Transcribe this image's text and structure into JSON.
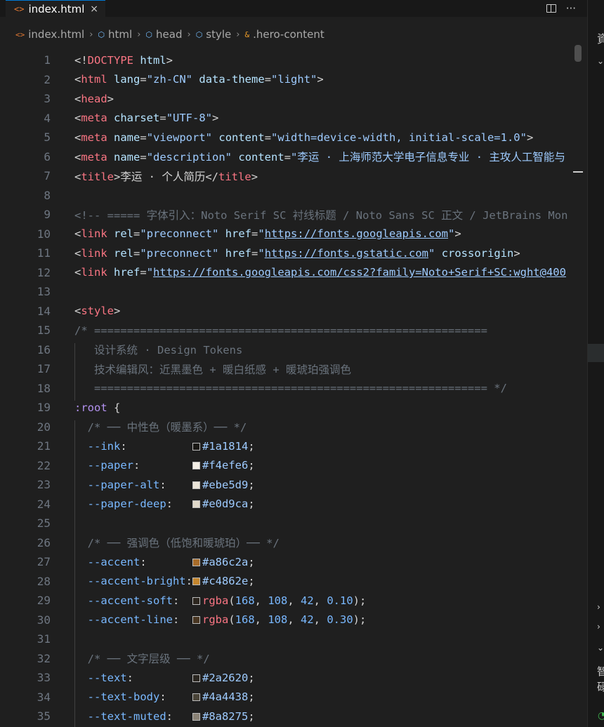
{
  "tab": {
    "icon": "<>",
    "label": "index.html",
    "close": "×"
  },
  "tab_actions": {
    "more": "···"
  },
  "breadcrumb": [
    {
      "icon": "<>",
      "kind": "html",
      "label": "index.html"
    },
    {
      "icon": "⬡",
      "kind": "elem",
      "label": "html"
    },
    {
      "icon": "⬡",
      "kind": "elem",
      "label": "head"
    },
    {
      "icon": "⬡",
      "kind": "elem",
      "label": "style"
    },
    {
      "icon": "&",
      "kind": "cls",
      "label": ".hero-content"
    }
  ],
  "lines": [
    [
      [
        "t-punc",
        "<!"
      ],
      [
        "t-doctype",
        "DOCTYPE"
      ],
      [
        "t-punc",
        " "
      ],
      [
        "t-attr",
        "html"
      ],
      [
        "t-punc",
        ">"
      ]
    ],
    [
      [
        "t-punc",
        "<"
      ],
      [
        "t-tag",
        "html"
      ],
      [
        "t-punc",
        " "
      ],
      [
        "t-attr",
        "lang"
      ],
      [
        "t-punc",
        "="
      ],
      [
        "t-str",
        "\"zh-CN\""
      ],
      [
        "t-punc",
        " "
      ],
      [
        "t-attr",
        "data-theme"
      ],
      [
        "t-punc",
        "="
      ],
      [
        "t-str",
        "\"light\""
      ],
      [
        "t-punc",
        ">"
      ]
    ],
    [
      [
        "t-punc",
        "<"
      ],
      [
        "t-tag",
        "head"
      ],
      [
        "t-punc",
        ">"
      ]
    ],
    [
      [
        "t-punc",
        "<"
      ],
      [
        "t-tag",
        "meta"
      ],
      [
        "t-punc",
        " "
      ],
      [
        "t-attr",
        "charset"
      ],
      [
        "t-punc",
        "="
      ],
      [
        "t-str",
        "\"UTF-8\""
      ],
      [
        "t-punc",
        ">"
      ]
    ],
    [
      [
        "t-punc",
        "<"
      ],
      [
        "t-tag",
        "meta"
      ],
      [
        "t-punc",
        " "
      ],
      [
        "t-attr",
        "name"
      ],
      [
        "t-punc",
        "="
      ],
      [
        "t-str",
        "\"viewport\""
      ],
      [
        "t-punc",
        " "
      ],
      [
        "t-attr",
        "content"
      ],
      [
        "t-punc",
        "="
      ],
      [
        "t-str",
        "\"width=device-width, initial-scale=1.0\""
      ],
      [
        "t-punc",
        ">"
      ]
    ],
    [
      [
        "t-punc",
        "<"
      ],
      [
        "t-tag",
        "meta"
      ],
      [
        "t-punc",
        " "
      ],
      [
        "t-attr",
        "name"
      ],
      [
        "t-punc",
        "="
      ],
      [
        "t-str",
        "\"description\""
      ],
      [
        "t-punc",
        " "
      ],
      [
        "t-attr",
        "content"
      ],
      [
        "t-punc",
        "="
      ],
      [
        "t-str",
        "\"李运 · 上海师范大学电子信息专业 · 主攻人工智能与"
      ]
    ],
    [
      [
        "t-punc",
        "<"
      ],
      [
        "t-tag",
        "title"
      ],
      [
        "t-punc",
        ">李运 · 个人简历</"
      ],
      [
        "t-tag",
        "title"
      ],
      [
        "t-punc",
        ">"
      ]
    ],
    [],
    [
      [
        "t-comment",
        "<!-- ===== 字体引入：Noto Serif SC 衬线标题 / Noto Sans SC 正文 / JetBrains Mon"
      ]
    ],
    [
      [
        "t-punc",
        "<"
      ],
      [
        "t-tag",
        "link"
      ],
      [
        "t-punc",
        " "
      ],
      [
        "t-attr",
        "rel"
      ],
      [
        "t-punc",
        "="
      ],
      [
        "t-str",
        "\"preconnect\""
      ],
      [
        "t-punc",
        " "
      ],
      [
        "t-attr",
        "href"
      ],
      [
        "t-punc",
        "="
      ],
      [
        "t-str",
        "\""
      ],
      [
        "t-url",
        "https://fonts.googleapis.com"
      ],
      [
        "t-str",
        "\""
      ],
      [
        "t-punc",
        ">"
      ]
    ],
    [
      [
        "t-punc",
        "<"
      ],
      [
        "t-tag",
        "link"
      ],
      [
        "t-punc",
        " "
      ],
      [
        "t-attr",
        "rel"
      ],
      [
        "t-punc",
        "="
      ],
      [
        "t-str",
        "\"preconnect\""
      ],
      [
        "t-punc",
        " "
      ],
      [
        "t-attr",
        "href"
      ],
      [
        "t-punc",
        "="
      ],
      [
        "t-str",
        "\""
      ],
      [
        "t-url",
        "https://fonts.gstatic.com"
      ],
      [
        "t-str",
        "\""
      ],
      [
        "t-punc",
        " "
      ],
      [
        "t-attr",
        "crossorigin"
      ],
      [
        "t-punc",
        ">"
      ]
    ],
    [
      [
        "t-punc",
        "<"
      ],
      [
        "t-tag",
        "link"
      ],
      [
        "t-punc",
        " "
      ],
      [
        "t-attr",
        "href"
      ],
      [
        "t-punc",
        "="
      ],
      [
        "t-str",
        "\""
      ],
      [
        "t-url",
        "https://fonts.googleapis.com/css2?family=Noto+Serif+SC:wght@400"
      ]
    ],
    [],
    [
      [
        "t-punc",
        "<"
      ],
      [
        "t-tag",
        "style"
      ],
      [
        "t-punc",
        ">"
      ]
    ],
    [
      [
        "t-comment",
        "/* ============================================================"
      ]
    ],
    [
      [
        "t-comment",
        "   设计系统 · Design Tokens"
      ]
    ],
    [
      [
        "t-comment",
        "   技术编辑风：近黑墨色 + 暖白纸感 + 暖琥珀强调色"
      ]
    ],
    [
      [
        "t-comment",
        "   ============================================================ */"
      ]
    ],
    [
      [
        "t-sel",
        ":root"
      ],
      [
        "t-punc",
        " {"
      ]
    ],
    [
      [
        "t-comment",
        "  /* ── 中性色（暖墨系）── */"
      ]
    ],
    [
      [
        "t-prop",
        "  --ink"
      ],
      [
        "t-punc",
        ":          "
      ],
      [
        "swatch",
        "#1a1814"
      ],
      [
        "t-val",
        "#1a1814"
      ],
      [
        "t-punc",
        ";"
      ]
    ],
    [
      [
        "t-prop",
        "  --paper"
      ],
      [
        "t-punc",
        ":        "
      ],
      [
        "swatch",
        "#f4efe6"
      ],
      [
        "t-val",
        "#f4efe6"
      ],
      [
        "t-punc",
        ";"
      ]
    ],
    [
      [
        "t-prop",
        "  --paper-alt"
      ],
      [
        "t-punc",
        ":    "
      ],
      [
        "swatch",
        "#ebe5d9"
      ],
      [
        "t-val",
        "#ebe5d9"
      ],
      [
        "t-punc",
        ";"
      ]
    ],
    [
      [
        "t-prop",
        "  --paper-deep"
      ],
      [
        "t-punc",
        ":   "
      ],
      [
        "swatch",
        "#e0d9ca"
      ],
      [
        "t-val",
        "#e0d9ca"
      ],
      [
        "t-punc",
        ";"
      ]
    ],
    [],
    [
      [
        "t-comment",
        "  /* ── 强调色（低饱和暖琥珀）── */"
      ]
    ],
    [
      [
        "t-prop",
        "  --accent"
      ],
      [
        "t-punc",
        ":       "
      ],
      [
        "swatch",
        "#a86c2a"
      ],
      [
        "t-val",
        "#a86c2a"
      ],
      [
        "t-punc",
        ";"
      ]
    ],
    [
      [
        "t-prop",
        "  --accent-bright"
      ],
      [
        "t-punc",
        ":"
      ],
      [
        "swatch",
        "#c4862e"
      ],
      [
        "t-val",
        "#c4862e"
      ],
      [
        "t-punc",
        ";"
      ]
    ],
    [
      [
        "t-prop",
        "  --accent-soft"
      ],
      [
        "t-punc",
        ":  "
      ],
      [
        "swatch",
        "rgba(168,108,42,0.10)"
      ],
      [
        "t-fn",
        "rgba"
      ],
      [
        "t-punc",
        "("
      ],
      [
        "t-num",
        "168"
      ],
      [
        "t-punc",
        ", "
      ],
      [
        "t-num",
        "108"
      ],
      [
        "t-punc",
        ", "
      ],
      [
        "t-num",
        "42"
      ],
      [
        "t-punc",
        ", "
      ],
      [
        "t-num",
        "0.10"
      ],
      [
        "t-punc",
        ");"
      ]
    ],
    [
      [
        "t-prop",
        "  --accent-line"
      ],
      [
        "t-punc",
        ":  "
      ],
      [
        "swatch",
        "rgba(168,108,42,0.30)"
      ],
      [
        "t-fn",
        "rgba"
      ],
      [
        "t-punc",
        "("
      ],
      [
        "t-num",
        "168"
      ],
      [
        "t-punc",
        ", "
      ],
      [
        "t-num",
        "108"
      ],
      [
        "t-punc",
        ", "
      ],
      [
        "t-num",
        "42"
      ],
      [
        "t-punc",
        ", "
      ],
      [
        "t-num",
        "0.30"
      ],
      [
        "t-punc",
        ");"
      ]
    ],
    [],
    [
      [
        "t-comment",
        "  /* ── 文字层级 ── */"
      ]
    ],
    [
      [
        "t-prop",
        "  --text"
      ],
      [
        "t-punc",
        ":         "
      ],
      [
        "swatch",
        "#2a2620"
      ],
      [
        "t-val",
        "#2a2620"
      ],
      [
        "t-punc",
        ";"
      ]
    ],
    [
      [
        "t-prop",
        "  --text-body"
      ],
      [
        "t-punc",
        ":    "
      ],
      [
        "swatch",
        "#4a4438"
      ],
      [
        "t-val",
        "#4a4438"
      ],
      [
        "t-punc",
        ";"
      ]
    ],
    [
      [
        "t-prop",
        "  --text-muted"
      ],
      [
        "t-punc",
        ":   "
      ],
      [
        "swatch",
        "#8a8275"
      ],
      [
        "t-val",
        "#8a8275"
      ],
      [
        "t-punc",
        ";"
      ]
    ]
  ],
  "right_panel": {
    "top_char": "資",
    "bottom_chars": [
      "智",
      "碌"
    ]
  }
}
